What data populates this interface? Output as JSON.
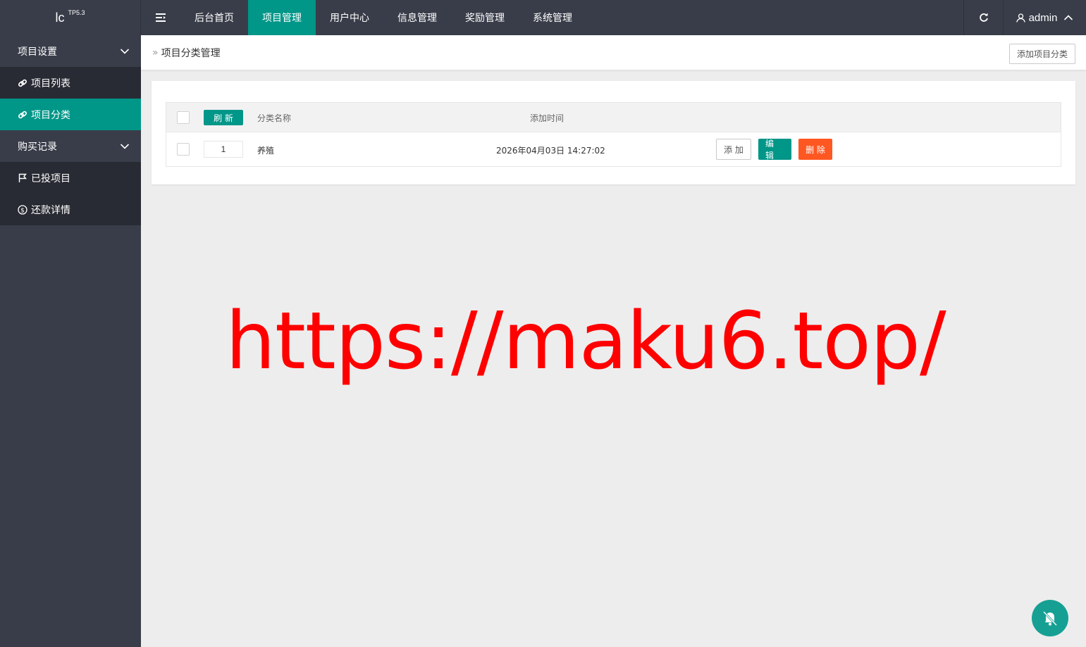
{
  "header": {
    "logo": "lc",
    "logo_sup": "TP5.3",
    "menu_toggle_icon": "menu-toggle-icon",
    "nav": [
      {
        "label": "后台首页",
        "active": false
      },
      {
        "label": "项目管理",
        "active": true
      },
      {
        "label": "用户中心",
        "active": false
      },
      {
        "label": "信息管理",
        "active": false
      },
      {
        "label": "奖励管理",
        "active": false
      },
      {
        "label": "系统管理",
        "active": false
      }
    ],
    "refresh_icon": "refresh-icon",
    "user": "admin"
  },
  "sidebar": {
    "group1": {
      "label": "项目设置"
    },
    "items1": [
      {
        "label": "项目列表",
        "icon": "link-icon"
      },
      {
        "label": "项目分类",
        "icon": "link-icon",
        "active": true
      }
    ],
    "group2": {
      "label": "购买记录"
    },
    "items2": [
      {
        "label": "已投项目",
        "icon": "flag-icon"
      },
      {
        "label": "还款详情",
        "icon": "dollar-icon"
      }
    ]
  },
  "breadcrumb": {
    "sep": "»",
    "text": "项目分类管理",
    "add_button": "添加项目分类"
  },
  "table": {
    "refresh_button": "刷 新",
    "col_name": "分类名称",
    "col_time": "添加时间",
    "rows": [
      {
        "sort": "1",
        "name": "养殖",
        "time": "2026年04月03日 14:27:02",
        "add": "添 加",
        "edit": "编 辑",
        "delete": "删 除"
      }
    ]
  },
  "watermark": "https://maku6.top/",
  "colors": {
    "primary": "#009688",
    "danger": "#ff5722",
    "dark": "#393d49",
    "darker": "#282b33",
    "watermark": "#ff0000"
  }
}
